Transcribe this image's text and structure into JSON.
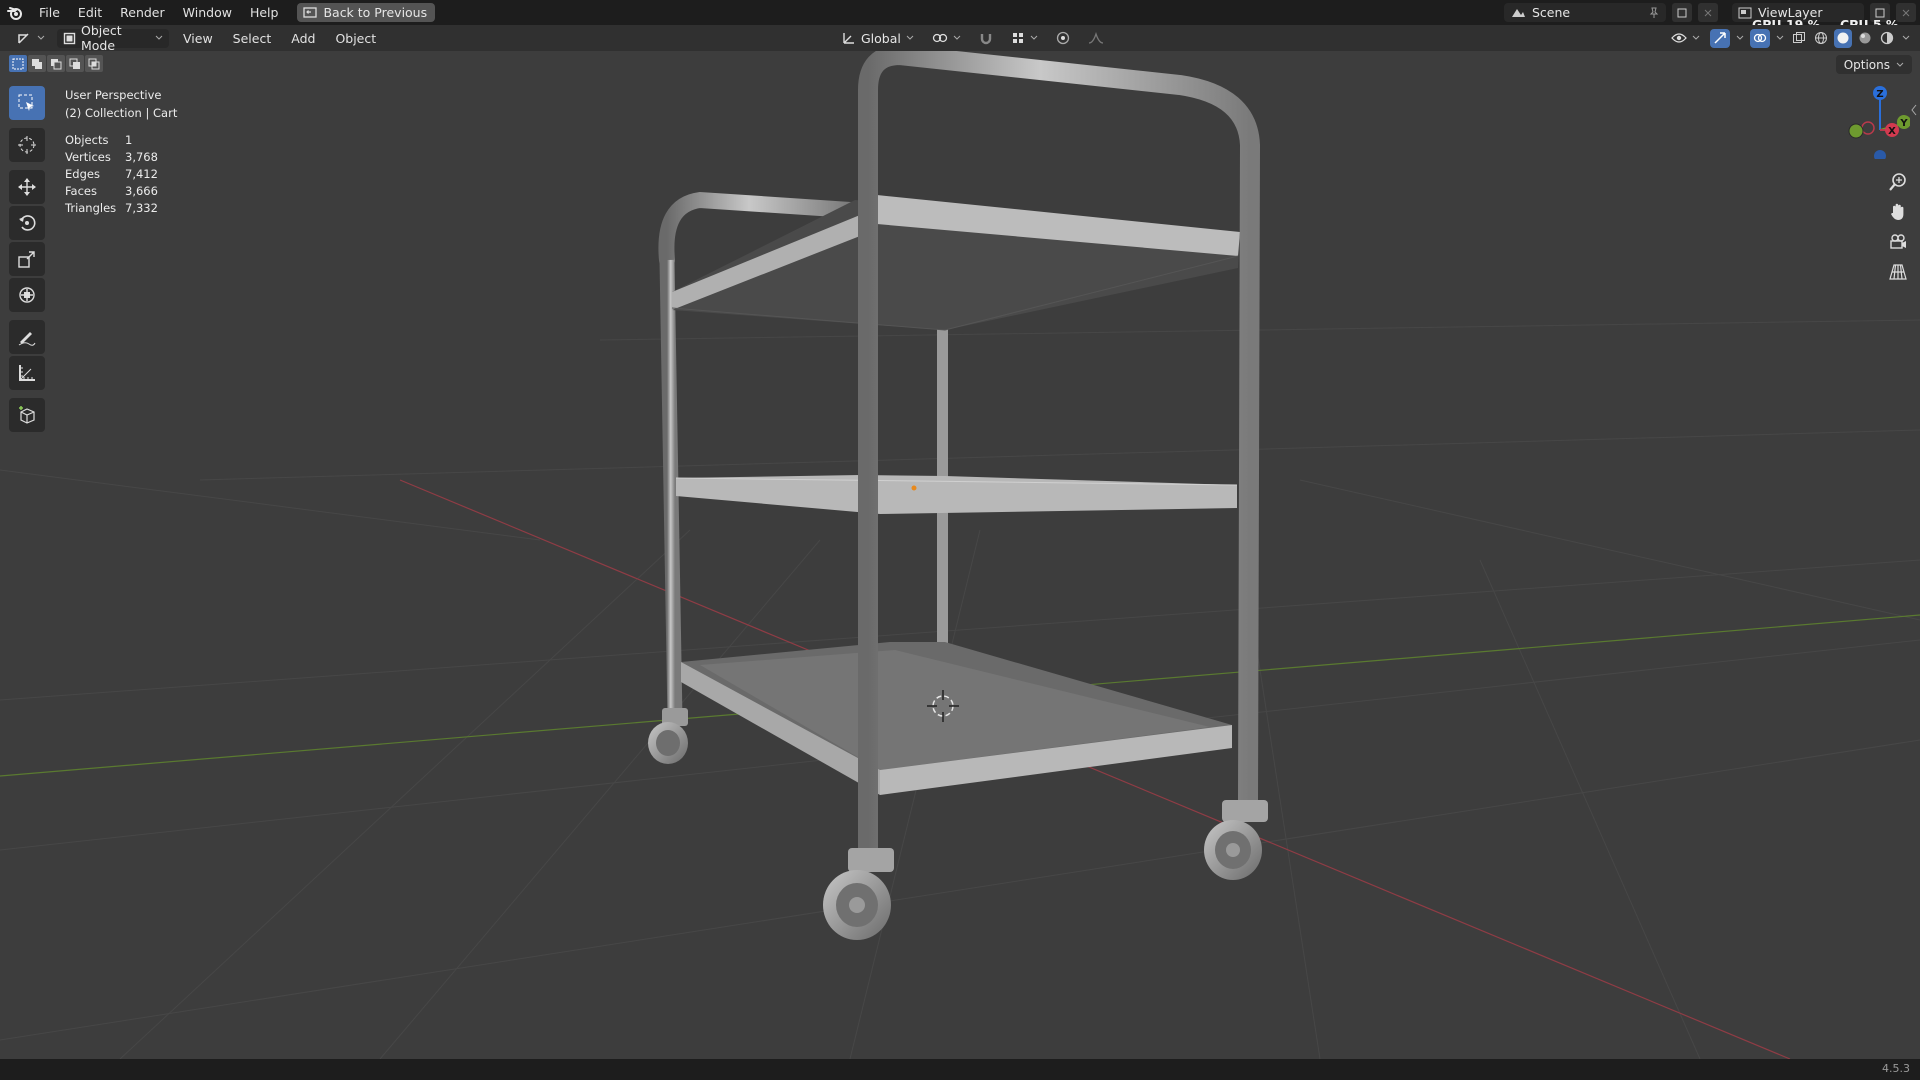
{
  "menubar": {
    "items": [
      "File",
      "Edit",
      "Render",
      "Window",
      "Help"
    ],
    "back_button": "Back to Previous",
    "scene": "Scene",
    "view_layer": "ViewLayer",
    "gpu_label": "GPU",
    "gpu_value": "19 %",
    "cpu_label": "CPU",
    "cpu_value": "5 %"
  },
  "header": {
    "mode": "Object Mode",
    "menus": [
      "View",
      "Select",
      "Add",
      "Object"
    ],
    "transform_orientation": "Global"
  },
  "viewport": {
    "view_name": "User Perspective",
    "collection": "(2) Collection | Cart",
    "stats": [
      {
        "label": "Objects",
        "value": "1"
      },
      {
        "label": "Vertices",
        "value": "3,768"
      },
      {
        "label": "Edges",
        "value": "7,412"
      },
      {
        "label": "Faces",
        "value": "3,666"
      },
      {
        "label": "Triangles",
        "value": "7,332"
      }
    ],
    "options_label": "Options",
    "gizmo": {
      "z": "Z",
      "x": "X",
      "y": "Y"
    }
  },
  "status": {
    "version": "4.5.3"
  },
  "colors": {
    "accent": "#4772b3",
    "viewport_bg": "#3d3d3d",
    "axis_x": "#b83a4b",
    "axis_y": "#6e9a2f",
    "axis_z": "#2a6fdb"
  }
}
